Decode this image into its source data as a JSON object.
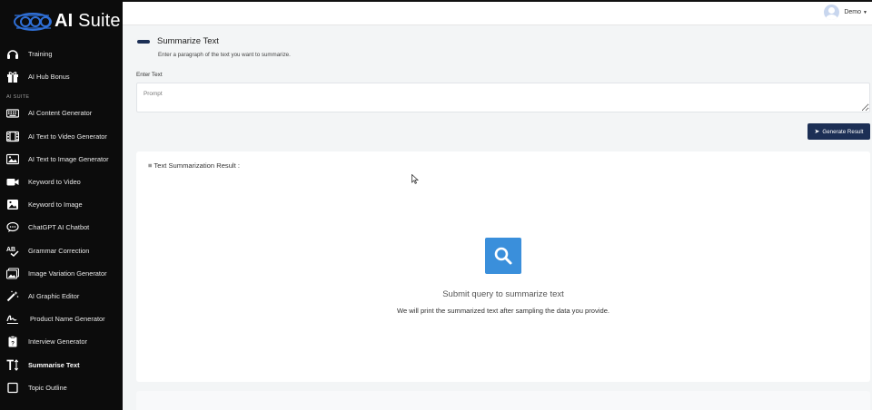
{
  "brand": {
    "prefix": "AI",
    "suffix": "Suite"
  },
  "sidebar": {
    "top_items": [
      {
        "label": "Training",
        "icon": "headset-icon"
      },
      {
        "label": "AI Hub Bonus",
        "icon": "gift-icon"
      }
    ],
    "section_label": "AI SUITE",
    "items": [
      {
        "label": "AI Content Generator",
        "icon": "keyboard-icon"
      },
      {
        "label": "AI Text to Video Generator",
        "icon": "film-icon"
      },
      {
        "label": "AI Text to Image Generator",
        "icon": "image-icon"
      },
      {
        "label": "Keyword to Video",
        "icon": "video-camera-icon"
      },
      {
        "label": "Keyword to Image",
        "icon": "picture-icon"
      },
      {
        "label": "ChatGPT AI Chatbot",
        "icon": "chat-bubble-icon"
      },
      {
        "label": "Grammar Correction",
        "icon": "spellcheck-icon"
      },
      {
        "label": "Image Variation Generator",
        "icon": "images-icon"
      },
      {
        "label": "AI Graphic Editor",
        "icon": "magic-wand-icon"
      },
      {
        "label": "Product Name Generator",
        "icon": "signature-icon"
      },
      {
        "label": "Interview Generator",
        "icon": "clipboard-icon"
      },
      {
        "label": "Summarise Text",
        "icon": "text-height-icon"
      },
      {
        "label": "Topic Outline",
        "icon": "outline-icon"
      }
    ]
  },
  "user": {
    "name": "Demo"
  },
  "page": {
    "title": "Summarize Text",
    "subtitle": "Enter a paragraph of the text you want to summarize.",
    "field_label": "Enter Text",
    "prompt_placeholder": "Prompt",
    "generate_label": "Generate Result"
  },
  "result": {
    "title": "Text Summarization Result :",
    "empty_title": "Submit query to summarize text",
    "empty_subtitle": "We will print the summarized text after sampling the data you provide."
  },
  "colors": {
    "sidebar_bg": "#0c0c0c",
    "accent": "#1c2f55",
    "search_icon_bg": "#3a8fdb"
  }
}
